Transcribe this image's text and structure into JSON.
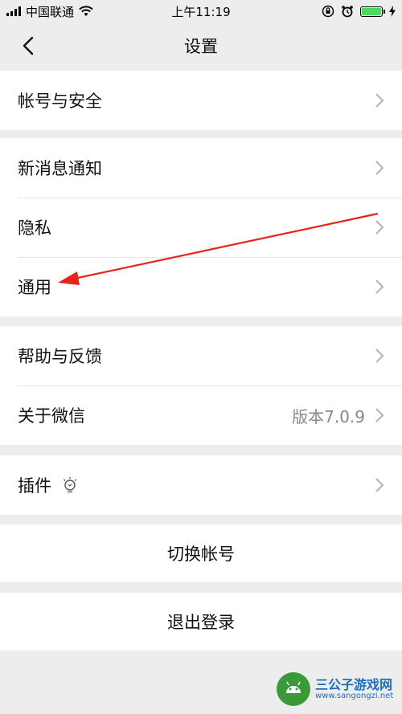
{
  "status_bar": {
    "carrier": "中国联通",
    "time": "上午11:19",
    "battery_color": "#4cd964"
  },
  "nav": {
    "title": "设置",
    "back_icon": "chevron-left-icon"
  },
  "groups": [
    {
      "items": [
        {
          "label": "帐号与安全"
        }
      ]
    },
    {
      "items": [
        {
          "label": "新消息通知"
        },
        {
          "label": "隐私"
        },
        {
          "label": "通用"
        }
      ]
    },
    {
      "items": [
        {
          "label": "帮助与反馈"
        },
        {
          "label": "关于微信",
          "value": "版本7.0.9"
        }
      ]
    },
    {
      "items": [
        {
          "label": "插件",
          "icon": "lightbulb-icon"
        }
      ]
    }
  ],
  "actions": {
    "switch_account": "切换帐号",
    "logout": "退出登录"
  },
  "annotation": {
    "arrow_color": "#e8231a",
    "points_to": "通用"
  },
  "watermark": {
    "name": "三公子游戏网",
    "url": "www.sangongzi.net"
  }
}
